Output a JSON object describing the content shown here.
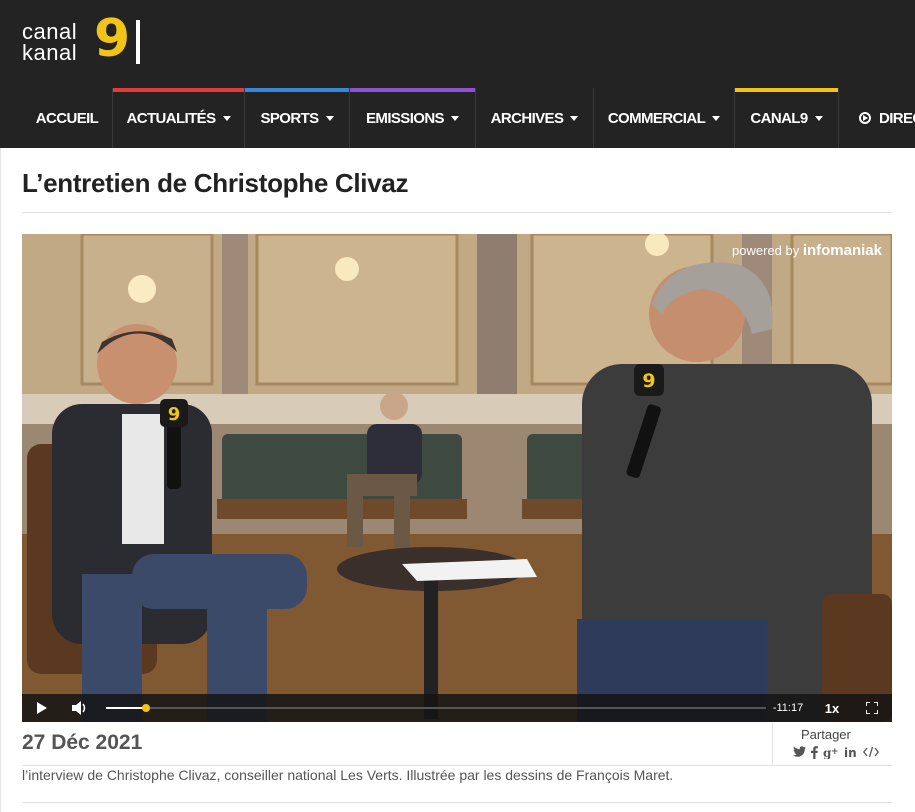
{
  "logo": {
    "line1": "canal",
    "line2": "kanal",
    "number": "9"
  },
  "nav": {
    "items": [
      {
        "label": "ACCUEIL",
        "caret": false,
        "accent": ""
      },
      {
        "label": "ACTUALITÉS",
        "caret": true,
        "accent": "#e23b3b"
      },
      {
        "label": "SPORTS",
        "caret": true,
        "accent": "#3a86d9"
      },
      {
        "label": "EMISSIONS",
        "caret": true,
        "accent": "#8e4fd0"
      },
      {
        "label": "ARCHIVES",
        "caret": true,
        "accent": ""
      },
      {
        "label": "COMMERCIAL",
        "caret": true,
        "accent": ""
      },
      {
        "label": "CANAL9",
        "caret": true,
        "accent": "#f2c418"
      },
      {
        "label": "DIREC",
        "caret": false,
        "accent": ""
      }
    ]
  },
  "article": {
    "title": "L’entretien de Christophe Clivaz",
    "date": "27 Déc 2021",
    "description": "l’interview de Christophe Clivaz, conseiller national Les Verts. Illustrée par les dessins de François Maret."
  },
  "player": {
    "powered_prefix": "powered by ",
    "powered_brand": "infomaniak",
    "time_remaining": "-11:17",
    "speed": "1x",
    "progress": 0.06
  },
  "share": {
    "label": "Partager",
    "icons": [
      "twitter-icon",
      "facebook-icon",
      "google-plus-icon",
      "linkedin-icon",
      "embed-icon"
    ]
  },
  "colors": {
    "header_bg": "#232323",
    "brand_yellow": "#f2c418"
  }
}
